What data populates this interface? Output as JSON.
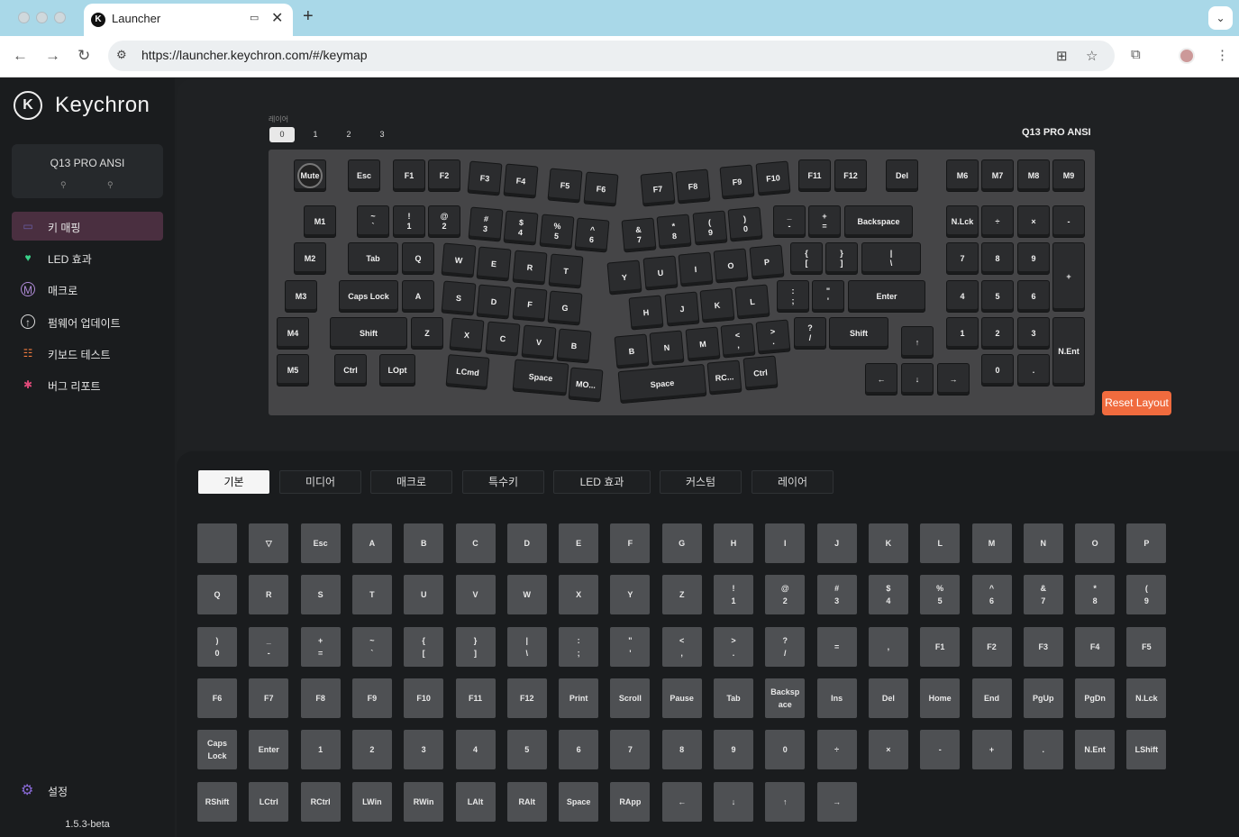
{
  "browser": {
    "tab_title": "Launcher",
    "url": "https://launcher.keychron.com/#/keymap",
    "close_glyph": "✕",
    "newtab_glyph": "+"
  },
  "sidebar": {
    "brand": "Keychron",
    "device_name": "Q13 PRO ANSI",
    "items": [
      {
        "label": "키 매핑",
        "icon": "keyboard-icon",
        "active": true
      },
      {
        "label": "LED 효과",
        "icon": "bulb-icon"
      },
      {
        "label": "매크로",
        "icon": "macro-m-icon"
      },
      {
        "label": "펌웨어 업데이트",
        "icon": "firmware-update-icon"
      },
      {
        "label": "키보드 테스트",
        "icon": "clipboard-test-icon"
      },
      {
        "label": "버그 리포트",
        "icon": "bug-icon"
      }
    ],
    "settings_label": "설정",
    "version": "1.5.3-beta"
  },
  "keymap": {
    "layer_label": "레이어",
    "layers": [
      "0",
      "1",
      "2",
      "3"
    ],
    "active_layer": "0",
    "keyboard_name": "Q13 PRO ANSI",
    "reset_label": "Reset Layout",
    "keys": [
      "Mute",
      "Esc",
      "F1",
      "F2",
      "F3",
      "F4",
      "F5",
      "F6",
      "F7",
      "F8",
      "F9",
      "F10",
      "F11",
      "F12",
      "Del",
      "M6",
      "M7",
      "M8",
      "M9",
      "M1",
      "~\n`",
      "!\n1",
      "@\n2",
      "#\n3",
      "$\n4",
      "%\n5",
      "^\n6",
      "&\n7",
      "*\n8",
      "(\n9",
      ")\n0",
      "_\n-",
      "+\n=",
      "Backspace",
      "N.Lck",
      "÷",
      "×",
      "-",
      "M2",
      "Tab",
      "Q",
      "W",
      "E",
      "R",
      "T",
      "Y",
      "U",
      "I",
      "O",
      "P",
      "{\n[",
      "}\n]",
      "|\n\\",
      "7",
      "8",
      "9",
      "+",
      "M3",
      "Caps Lock",
      "A",
      "S",
      "D",
      "F",
      "G",
      "H",
      "J",
      "K",
      "L",
      ":\n;",
      "\"\n'",
      "Enter",
      "4",
      "5",
      "6",
      "M4",
      "Shift",
      "Z",
      "X",
      "C",
      "V",
      "B",
      "B",
      "N",
      "M",
      "<\n,",
      ">\n.",
      "?\n/",
      "Shift",
      "↑",
      "1",
      "2",
      "3",
      "N.Ent",
      "M5",
      "Ctrl",
      "LOpt",
      "LCmd",
      "Space",
      "MO...",
      "Space",
      "RC...",
      "Ctrl",
      "←",
      "↓",
      "→",
      "0",
      "."
    ]
  },
  "palette": {
    "categories": [
      "기본",
      "미디어",
      "매크로",
      "특수키",
      "LED 효과",
      "커스텀",
      "레이어"
    ],
    "active_category": "기본",
    "keys": [
      "",
      "▽",
      "Esc",
      "A",
      "B",
      "C",
      "D",
      "E",
      "F",
      "G",
      "H",
      "I",
      "J",
      "K",
      "L",
      "M",
      "N",
      "O",
      "P",
      "Q",
      "R",
      "S",
      "T",
      "U",
      "V",
      "W",
      "X",
      "Y",
      "Z",
      "!\n1",
      "@\n2",
      "#\n3",
      "$\n4",
      "%\n5",
      "^\n6",
      "&\n7",
      "*\n8",
      "(\n9",
      ")\n0",
      "_\n-",
      "+\n=",
      "~\n`",
      "{\n[",
      "}\n]",
      "|\n\\",
      ":\n;",
      "\"\n'",
      "<\n,",
      ">\n.",
      "?\n/",
      "=",
      ",",
      "F1",
      "F2",
      "F3",
      "F4",
      "F5",
      "F6",
      "F7",
      "F8",
      "F9",
      "F10",
      "F11",
      "F12",
      "Print",
      "Scroll",
      "Pause",
      "Tab",
      "Backsp\nace",
      "Ins",
      "Del",
      "Home",
      "End",
      "PgUp",
      "PgDn",
      "N.Lck",
      "Caps\nLock",
      "Enter",
      "1",
      "2",
      "3",
      "4",
      "5",
      "6",
      "7",
      "8",
      "9",
      "0",
      "÷",
      "×",
      "-",
      "+",
      ".",
      "N.Ent",
      "LShift",
      "RShift",
      "LCtrl",
      "RCtrl",
      "LWin",
      "RWin",
      "LAlt",
      "RAlt",
      "Space",
      "RApp",
      "←",
      "↓",
      "↑",
      "→"
    ]
  }
}
